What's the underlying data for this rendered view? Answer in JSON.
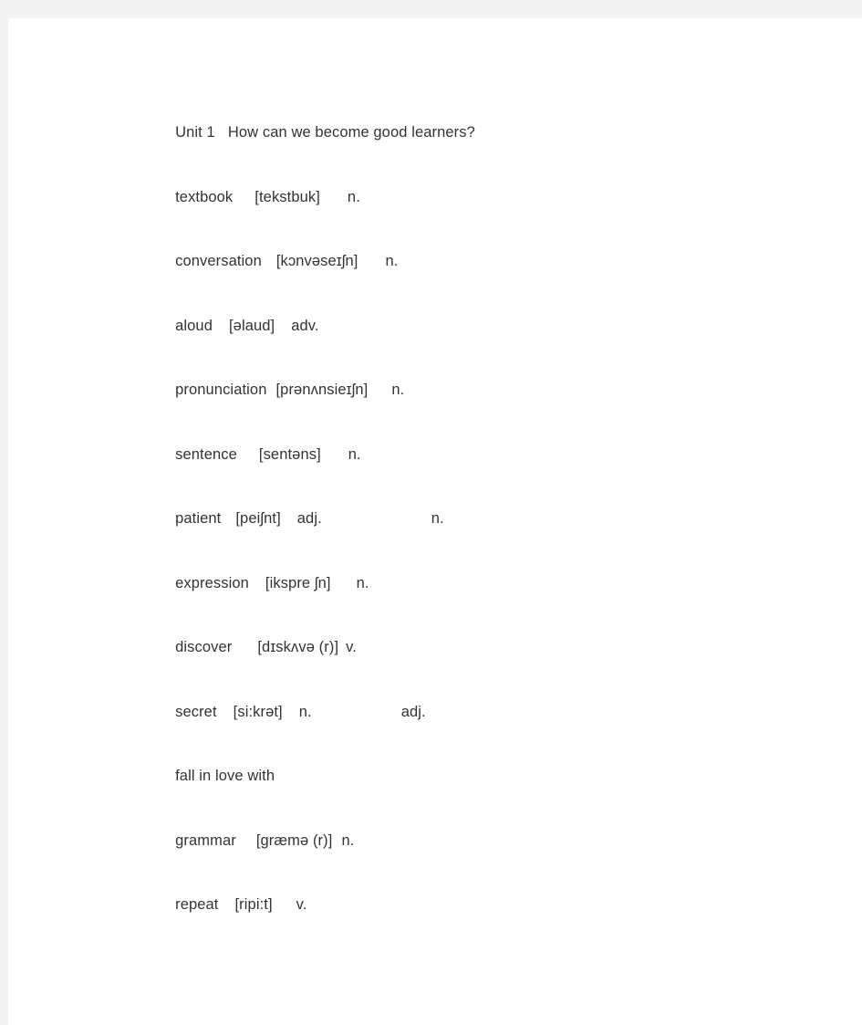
{
  "document": {
    "heading": "Unit 1   How can we become good learners?",
    "entries": [
      {
        "word": "textbook",
        "gap1": 24,
        "phonetic": "[tekstbuk]",
        "gap2": 30,
        "pos": "n.",
        "gap3": 0,
        "pos_extra": ""
      },
      {
        "word": "conversation",
        "gap1": 16,
        "phonetic": "[kɔnvəseɪʃn]",
        "gap2": 30,
        "pos": "n.",
        "gap3": 0,
        "pos_extra": ""
      },
      {
        "word": "aloud",
        "gap1": 18,
        "phonetic": "[əlaud]",
        "gap2": 18,
        "pos": "adv.",
        "gap3": 0,
        "pos_extra": ""
      },
      {
        "word": "pronunciation",
        "gap1": 10,
        "phonetic": "[prənʌnsieɪʃn]",
        "gap2": 26,
        "pos": "n.",
        "gap3": 0,
        "pos_extra": ""
      },
      {
        "word": "sentence",
        "gap1": 24,
        "phonetic": "[sentəns]",
        "gap2": 30,
        "pos": "n.",
        "gap3": 0,
        "pos_extra": ""
      },
      {
        "word": "patient",
        "gap1": 16,
        "phonetic": "[peiʃnt]",
        "gap2": 18,
        "pos": "adj.",
        "gap3": 120,
        "pos_extra": "n."
      },
      {
        "word": "expression",
        "gap1": 18,
        "phonetic": "[ikspre ʃn]",
        "gap2": 28,
        "pos": "n.",
        "gap3": 0,
        "pos_extra": ""
      },
      {
        "word": "discover",
        "gap1": 28,
        "phonetic": "[dɪskʌvə (r)]",
        "gap2": 8,
        "pos": "v.",
        "gap3": 0,
        "pos_extra": ""
      },
      {
        "word": "secret",
        "gap1": 18,
        "phonetic": "[si:krət]",
        "gap2": 18,
        "pos": "n.",
        "gap3": 98,
        "pos_extra": "adj."
      },
      {
        "word": "fall in love with",
        "gap1": 0,
        "phonetic": "",
        "gap2": 0,
        "pos": "",
        "gap3": 0,
        "pos_extra": ""
      },
      {
        "word": "grammar",
        "gap1": 22,
        "phonetic": "[græmə (r)]",
        "gap2": 10,
        "pos": "n.",
        "gap3": 0,
        "pos_extra": ""
      },
      {
        "word": "repeat",
        "gap1": 18,
        "phonetic": "[ripi:t]",
        "gap2": 26,
        "pos": "v.",
        "gap3": 0,
        "pos_extra": ""
      }
    ]
  },
  "colors": {
    "page_background": "#ffffff",
    "outer_background": "#f3f3f4",
    "text": "#333333"
  }
}
